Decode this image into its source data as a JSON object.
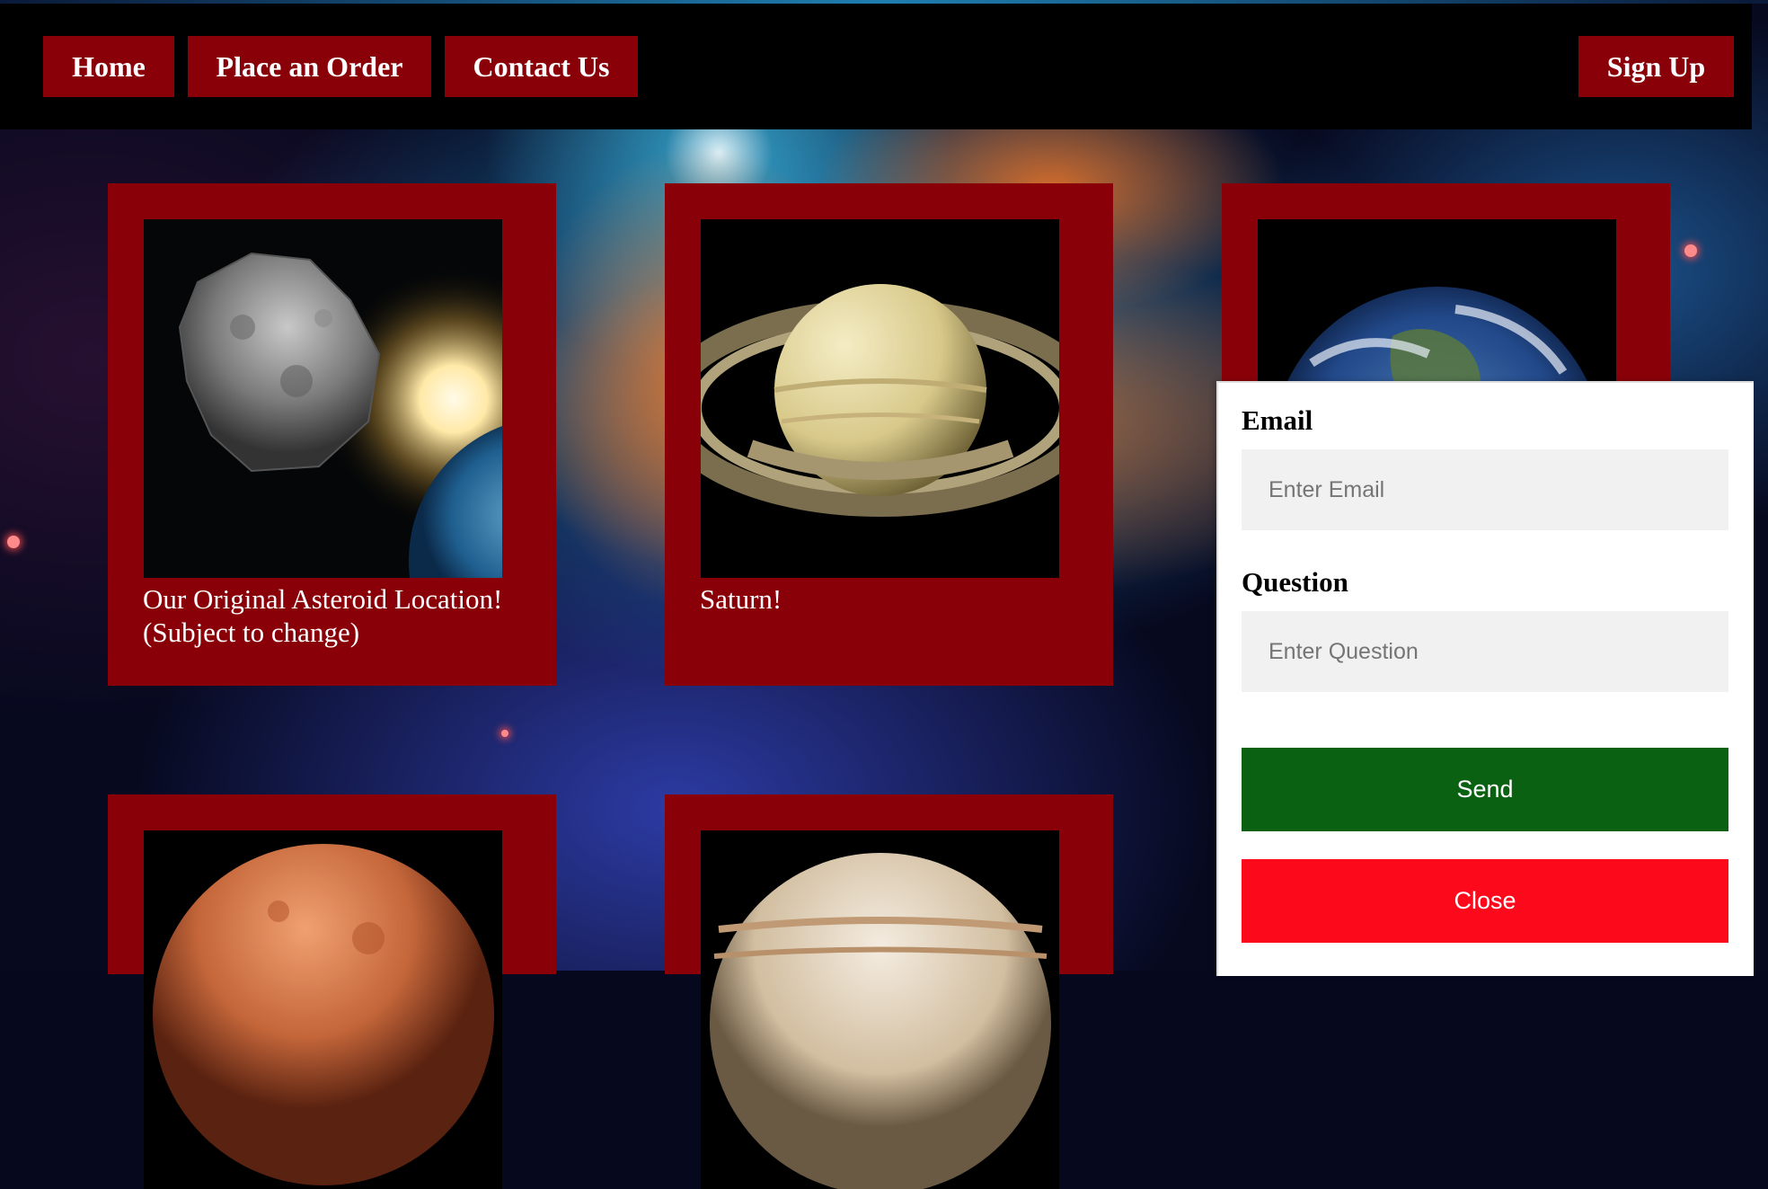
{
  "nav": {
    "home": "Home",
    "order": "Place an Order",
    "contact": "Contact Us",
    "signup": "Sign Up"
  },
  "cards": [
    {
      "caption": "Our Original Asteroid Location! (Subject to change)",
      "image": "asteroid-image"
    },
    {
      "caption": "Saturn!",
      "image": "saturn-image"
    },
    {
      "caption": "",
      "image": "earth-image"
    },
    {
      "caption": "",
      "image": "mars-image"
    },
    {
      "caption": "",
      "image": "jupiter-image"
    }
  ],
  "modal": {
    "email_label": "Email",
    "email_placeholder": "Enter Email",
    "question_label": "Question",
    "question_placeholder": "Enter Question",
    "send_label": "Send",
    "close_label": "Close"
  },
  "colors": {
    "nav_button": "#8a0008",
    "card": "#8a0008",
    "send": "#0b6112",
    "close": "#fc0a1c"
  }
}
